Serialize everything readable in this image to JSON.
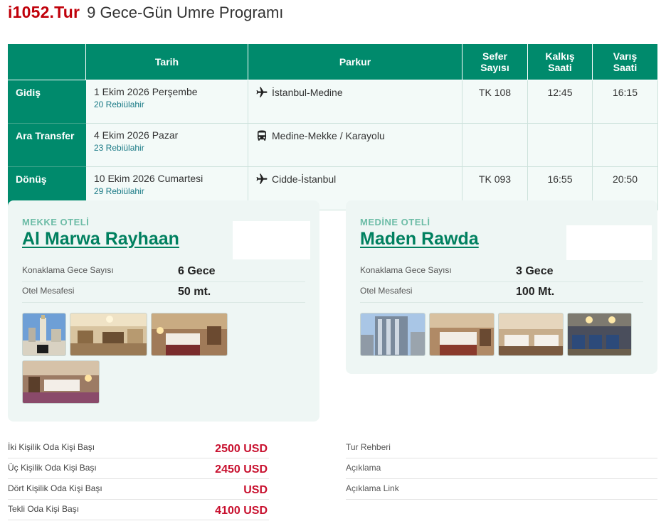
{
  "header": {
    "brand": "i1052.Tur",
    "title": "9 Gece-Gün Umre Programı"
  },
  "schedule": {
    "columns": {
      "date": "Tarih",
      "route": "Parkur",
      "flight": "Sefer Sayısı",
      "dep": "Kalkış Saati",
      "arr": "Varış Saati"
    },
    "rows": [
      {
        "label": "Gidiş",
        "date": "1 Ekim 2026 Perşembe",
        "hijri": "20 Rebiülahir",
        "icon": "airplane-icon",
        "route": "İstanbul-Medine",
        "flight": "TK 108",
        "dep": "12:45",
        "arr": "16:15"
      },
      {
        "label": "Ara Transfer",
        "date": "4 Ekim 2026 Pazar",
        "hijri": "23 Rebiülahir",
        "icon": "bus-icon",
        "route": "Medine-Mekke / Karayolu",
        "flight": "",
        "dep": "",
        "arr": ""
      },
      {
        "label": "Dönüş",
        "date": "10 Ekim 2026 Cumartesi",
        "hijri": "29 Rebiülahir",
        "icon": "airplane-icon",
        "route": "Cidde-İstanbul",
        "flight": "TK 093",
        "dep": "16:55",
        "arr": "20:50"
      }
    ]
  },
  "hotels": {
    "mekke": {
      "label": "MEKKE OTELİ",
      "name": "Al Marwa Rayhaan",
      "nights_label": "Konaklama Gece Sayısı",
      "nights": "6 Gece",
      "distance_label": "Otel Mesafesi",
      "distance": "50 mt."
    },
    "medine": {
      "label": "MEDİNE OTELİ",
      "name": "Maden Rawda",
      "nights_label": "Konaklama Gece Sayısı",
      "nights": "3 Gece",
      "distance_label": "Otel Mesafesi",
      "distance": "100 Mt."
    }
  },
  "prices": [
    {
      "label": "İki Kişilik Oda Kişi Başı",
      "value": "2500 USD"
    },
    {
      "label": "Üç Kişilik Oda Kişi Başı",
      "value": "2450 USD"
    },
    {
      "label": "Dört Kişilik Oda Kişi Başı",
      "value": "USD"
    },
    {
      "label": "Tekli Oda Kişi Başı",
      "value": "4100 USD"
    }
  ],
  "info": {
    "guide": "Tur Rehberi",
    "desc": "Açıklama",
    "desc_link": "Açıklama Link"
  },
  "colors": {
    "brand": "#c0000a",
    "teal": "#008a6c",
    "price": "#c8102e",
    "card": "#eef6f4"
  }
}
